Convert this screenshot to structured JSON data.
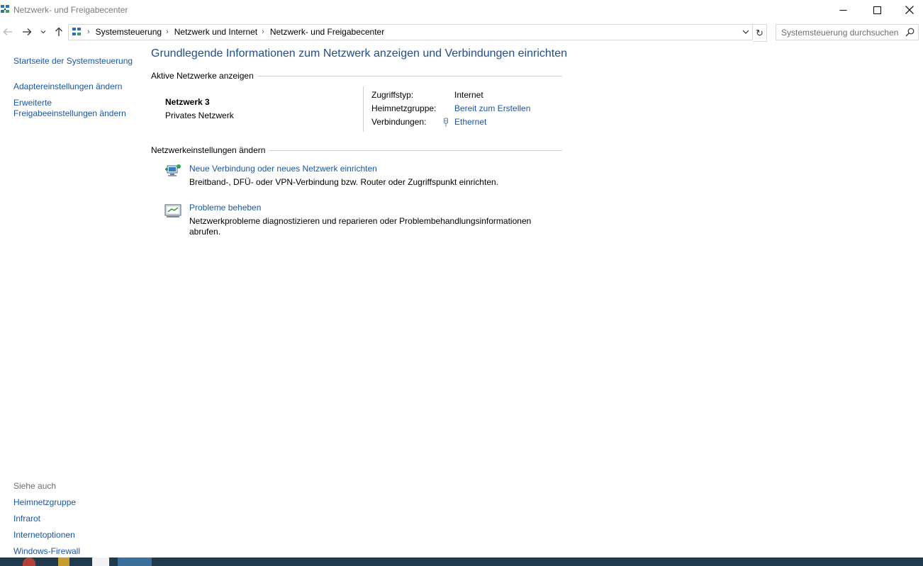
{
  "window": {
    "title": "Netzwerk- und Freigabecenter",
    "minimize_glyph": "—",
    "maximize_glyph": "☐",
    "close_glyph": "✕"
  },
  "nav": {
    "back_glyph": "←",
    "forward_glyph": "→",
    "recent_glyph": "⌄",
    "up_glyph": "↑",
    "breadcrumbs": [
      "Systemsteuerung",
      "Netzwerk und Internet",
      "Netzwerk- und Freigabecenter"
    ],
    "crumb_separator": "›",
    "refresh_glyph": "↻",
    "search_placeholder": "Systemsteuerung durchsuchen"
  },
  "sidebar": {
    "links": [
      {
        "label": "Startseite der Systemsteuerung"
      },
      {
        "label": "Adaptereinstellungen ändern"
      },
      {
        "label_line1": "Erweiterte",
        "label_line2": "Freigabeeinstellungen ändern"
      }
    ],
    "see_also_heading": "Siehe auch",
    "see_also": [
      "Heimnetzgruppe",
      "Infrarot",
      "Internetoptionen",
      "Windows-Firewall"
    ]
  },
  "main": {
    "title": "Grundlegende Informationen zum Netzwerk anzeigen und Verbindungen einrichten",
    "active_networks_heading": "Aktive Netzwerke anzeigen",
    "network": {
      "name": "Netzwerk  3",
      "type": "Privates Netzwerk",
      "access_type_label": "Zugriffstyp:",
      "access_type_value": "Internet",
      "homegroup_label": "Heimnetzgruppe:",
      "homegroup_value": "Bereit zum Erstellen",
      "connections_label": "Verbindungen:",
      "connections_value": "Ethernet"
    },
    "change_settings_heading": "Netzwerkeinstellungen ändern",
    "tasks": [
      {
        "title": "Neue Verbindung oder neues Netzwerk einrichten",
        "description": "Breitband-, DFÜ- oder VPN-Verbindung bzw. Router oder Zugriffspunkt einrichten."
      },
      {
        "title": "Probleme beheben",
        "description": "Netzwerkprobleme diagnostizieren und reparieren oder Problembehandlungsinformationen abrufen."
      }
    ]
  },
  "colors": {
    "link": "#1a56a5",
    "title": "#1e4e8c",
    "taskbar": "#1f3a4d"
  }
}
